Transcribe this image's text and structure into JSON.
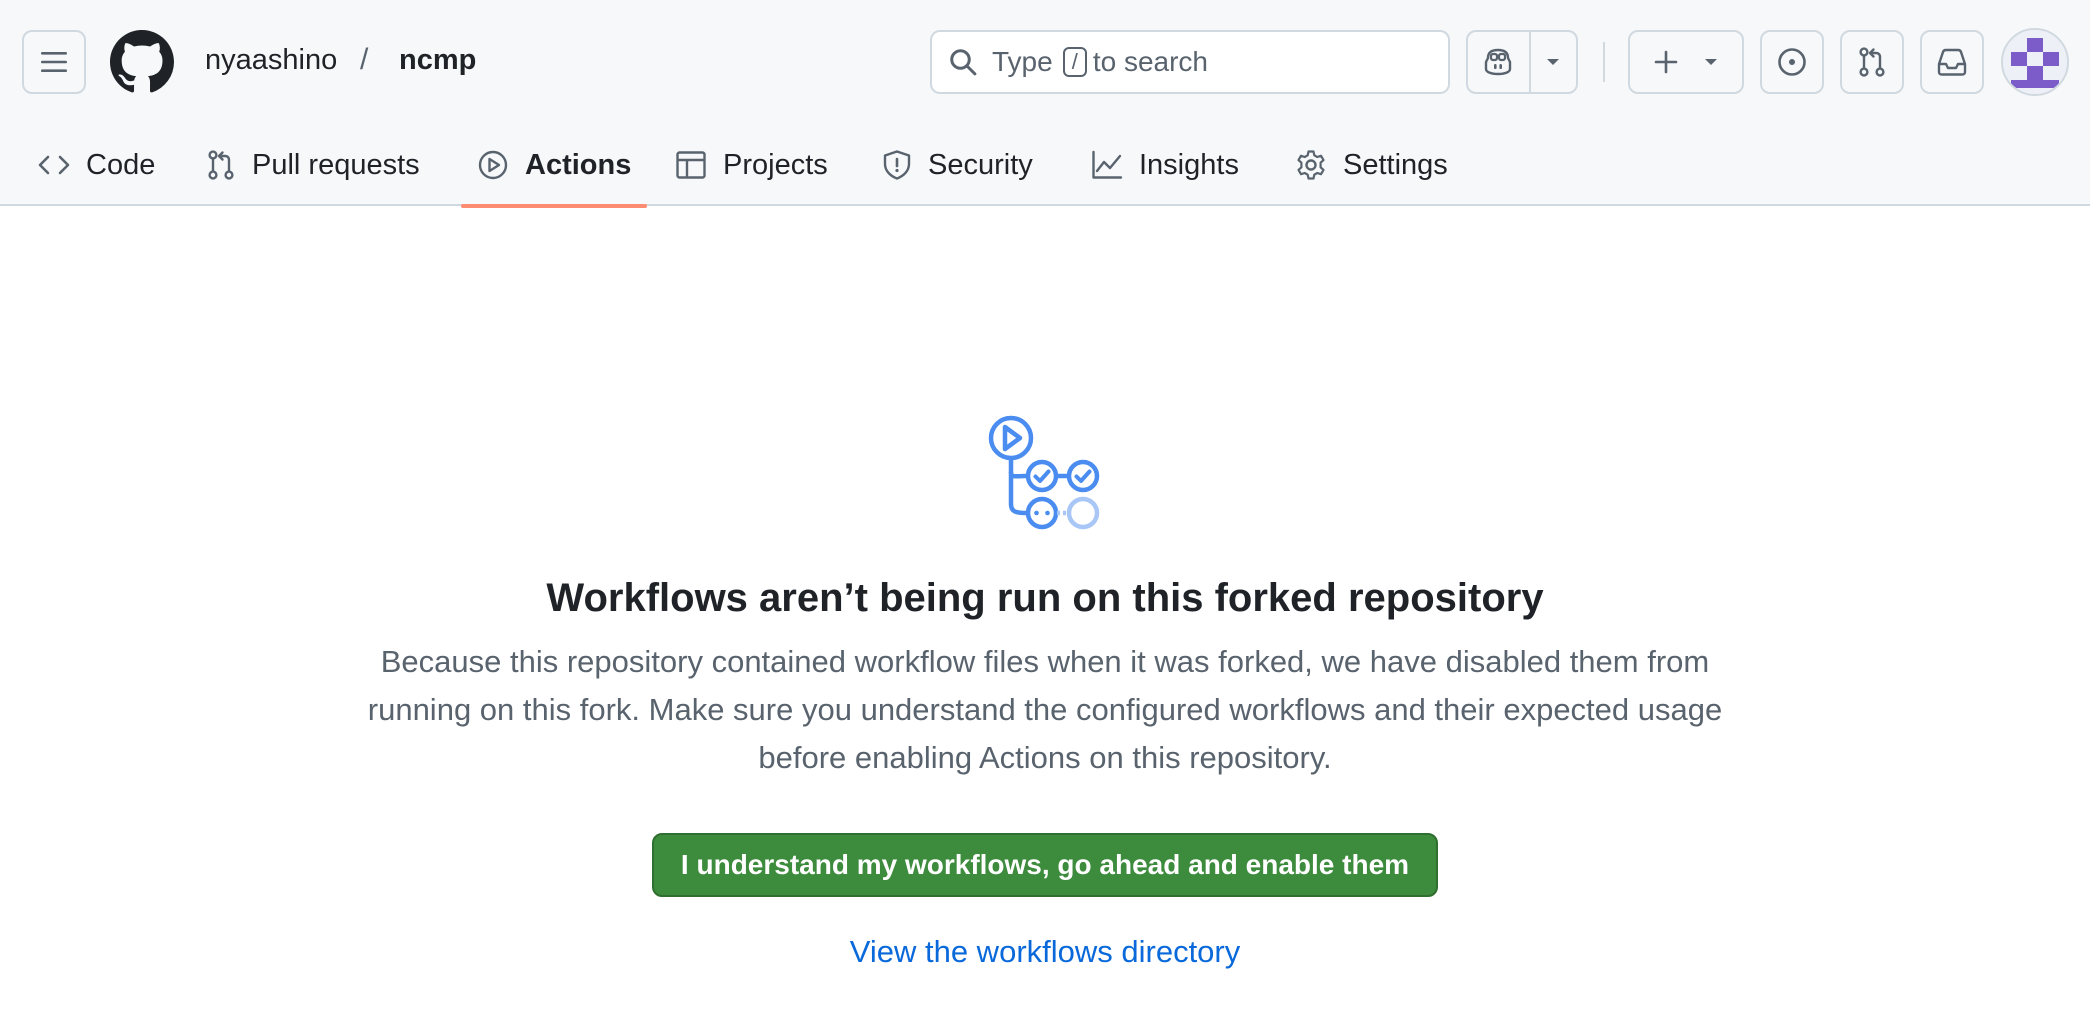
{
  "header": {
    "owner": "nyaashino",
    "separator": "/",
    "repo": "ncmp",
    "search": {
      "prefix": "Type",
      "key": "/",
      "suffix": "to search"
    }
  },
  "tabs": [
    {
      "label": "Code",
      "icon": "code-icon"
    },
    {
      "label": "Pull requests",
      "icon": "git-pull-request-icon"
    },
    {
      "label": "Actions",
      "icon": "play-icon",
      "active": true
    },
    {
      "label": "Projects",
      "icon": "table-icon"
    },
    {
      "label": "Security",
      "icon": "shield-icon"
    },
    {
      "label": "Insights",
      "icon": "graph-icon"
    },
    {
      "label": "Settings",
      "icon": "gear-icon"
    }
  ],
  "main": {
    "heading": "Workflows aren’t being run on this forked repository",
    "description": "Because this repository contained workflow files when it was forked, we have disabled them from running on this fork. Make sure you understand the configured workflows and their expected usage before enabling Actions on this repository.",
    "enable_button": "I understand my workflows, go ahead and enable them",
    "directory_link": "View the workflows directory"
  },
  "colors": {
    "accent_blue": "#0969da",
    "primary_green": "#3d8b3d",
    "tab_underline": "#fd8c73",
    "workflow_icon": "#4a8cf0"
  }
}
